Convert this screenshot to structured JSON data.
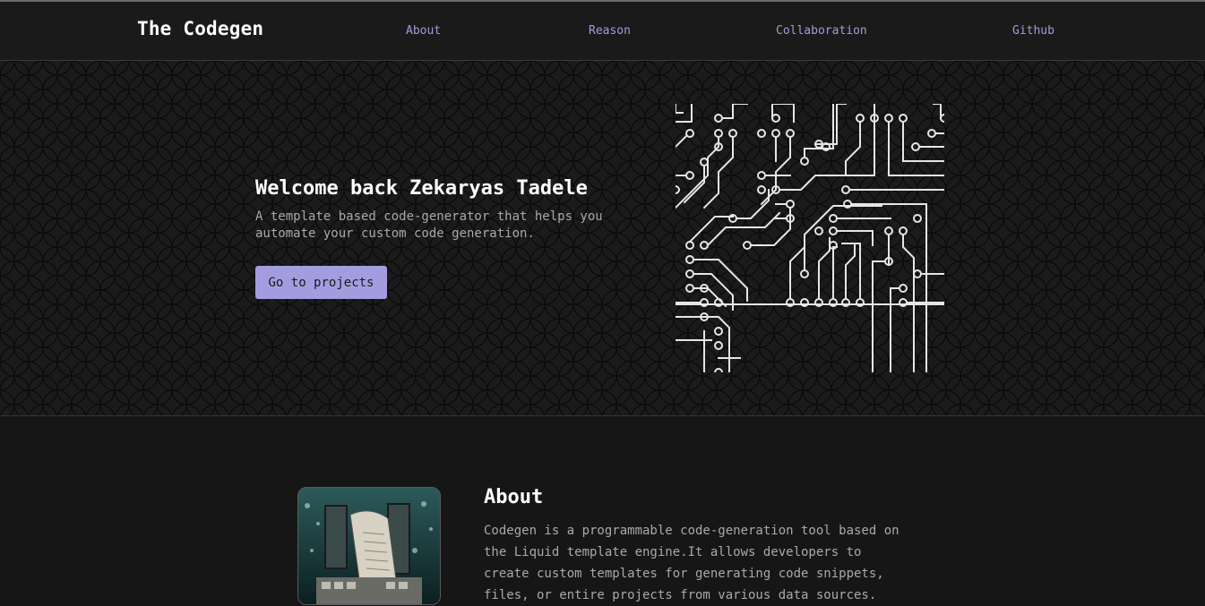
{
  "navbar": {
    "brand": "The Codegen",
    "links": [
      "About",
      "Reason",
      "Collaboration",
      "Github"
    ]
  },
  "hero": {
    "title": "Welcome back Zekaryas Tadele",
    "subtitle": "A template based code-generator that helps you automate your custom code generation.",
    "button_label": "Go to projects"
  },
  "about": {
    "title": "About",
    "text": "Codegen is a programmable code-generation tool based on the Liquid template engine.It allows developers to create custom templates for generating code snippets, files, or entire projects from various data sources."
  },
  "colors": {
    "accent": "#a39de0",
    "nav_link": "#a59bd8",
    "background": "#161616"
  }
}
